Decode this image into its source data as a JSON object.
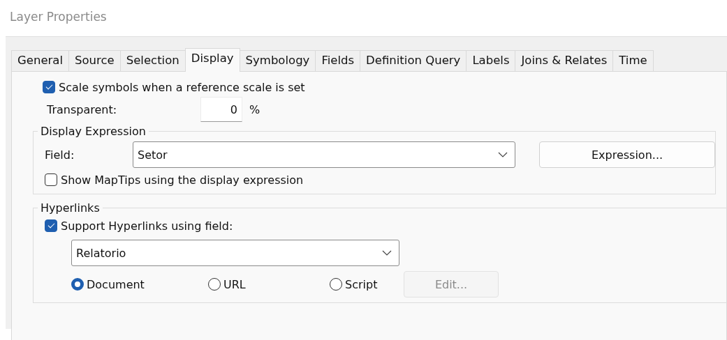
{
  "window": {
    "title": "Layer Properties"
  },
  "tabs": [
    {
      "label": "General",
      "selected": false
    },
    {
      "label": "Source",
      "selected": false
    },
    {
      "label": "Selection",
      "selected": false
    },
    {
      "label": "Display",
      "selected": true
    },
    {
      "label": "Symbology",
      "selected": false
    },
    {
      "label": "Fields",
      "selected": false
    },
    {
      "label": "Definition Query",
      "selected": false
    },
    {
      "label": "Labels",
      "selected": false
    },
    {
      "label": "Joins & Relates",
      "selected": false
    },
    {
      "label": "Time",
      "selected": false
    }
  ],
  "scale_symbols": {
    "label": "Scale symbols when a reference scale is set",
    "checked": true
  },
  "transparent": {
    "label": "Transparent:",
    "value": "0",
    "unit": "%"
  },
  "display_expression": {
    "title": "Display Expression",
    "field_label": "Field:",
    "field_value": "Setor",
    "button": "Expression...",
    "maptips": {
      "label": "Show MapTips using the display expression",
      "checked": false
    }
  },
  "hyperlinks": {
    "title": "Hyperlinks",
    "support": {
      "label": "Support Hyperlinks using field:",
      "checked": true
    },
    "field_value": "Relatorio",
    "options": [
      {
        "label": "Document",
        "selected": true
      },
      {
        "label": "URL",
        "selected": false
      },
      {
        "label": "Script",
        "selected": false
      }
    ],
    "edit_button": {
      "label": "Edit...",
      "disabled": true
    }
  }
}
